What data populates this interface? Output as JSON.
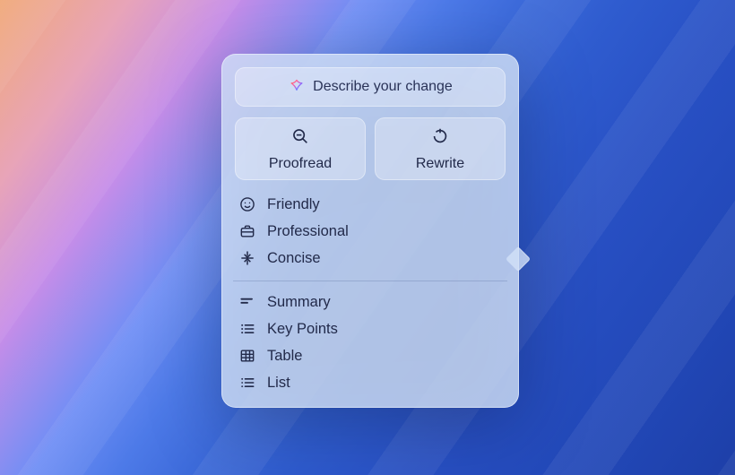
{
  "describe": {
    "placeholder": "Describe your change"
  },
  "actions": {
    "proofread": "Proofread",
    "rewrite": "Rewrite"
  },
  "tones": [
    {
      "id": "friendly",
      "label": "Friendly"
    },
    {
      "id": "professional",
      "label": "Professional"
    },
    {
      "id": "concise",
      "label": "Concise"
    }
  ],
  "formats": [
    {
      "id": "summary",
      "label": "Summary"
    },
    {
      "id": "keypoints",
      "label": "Key Points"
    },
    {
      "id": "table",
      "label": "Table"
    },
    {
      "id": "list",
      "label": "List"
    }
  ]
}
